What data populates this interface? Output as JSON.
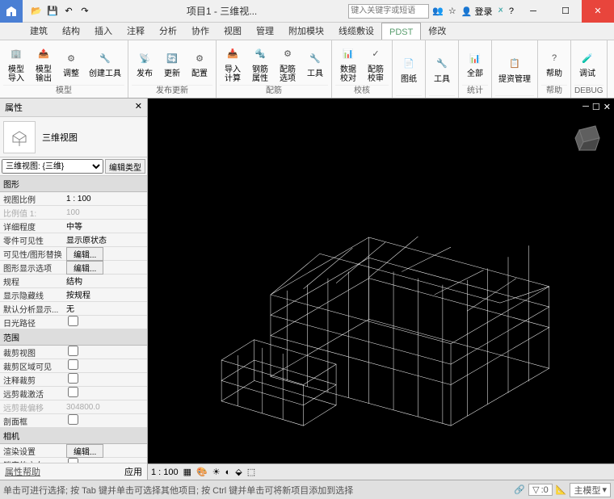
{
  "title": "项目1 - 三维视...",
  "searchPlaceholder": "键入关键字或短语",
  "login": "登录",
  "menus": [
    "建筑",
    "结构",
    "插入",
    "注释",
    "分析",
    "协作",
    "视图",
    "管理",
    "附加模块",
    "线缆敷设",
    "PDST",
    "修改"
  ],
  "activeMenu": 10,
  "ribbonGroups": [
    {
      "label": "模型",
      "items": [
        {
          "l": "模型\n导入"
        },
        {
          "l": "模型\n输出"
        },
        {
          "l": "调整"
        },
        {
          "l": "创建工具"
        }
      ]
    },
    {
      "label": "发布更新",
      "items": [
        {
          "l": "发布"
        },
        {
          "l": "更新"
        },
        {
          "l": "配置"
        }
      ]
    },
    {
      "label": "配筋",
      "items": [
        {
          "l": "导入\n计算"
        },
        {
          "l": "钢筋\n属性"
        },
        {
          "l": "配筋\n选项"
        },
        {
          "l": "工具"
        }
      ]
    },
    {
      "label": "校核",
      "items": [
        {
          "l": "数据\n校对"
        },
        {
          "l": "配筋\n校审"
        }
      ]
    },
    {
      "label": "",
      "items": [
        {
          "l": "图纸"
        }
      ]
    },
    {
      "label": "",
      "items": [
        {
          "l": "工具"
        }
      ]
    },
    {
      "label": "统计",
      "items": [
        {
          "l": "全部"
        }
      ]
    },
    {
      "label": "",
      "items": [
        {
          "l": "提资管理"
        }
      ]
    },
    {
      "label": "帮助",
      "items": [
        {
          "l": "帮助"
        }
      ]
    },
    {
      "label": "DEBUG",
      "items": [
        {
          "l": "调试"
        }
      ]
    }
  ],
  "props": {
    "title": "属性",
    "viewName": "三维视图",
    "selectorLabel": "三维视图: {三维}",
    "editType": "编辑类型",
    "sections": [
      {
        "name": "图形",
        "rows": [
          {
            "k": "视图比例",
            "v": "1 : 100",
            "t": "text"
          },
          {
            "k": "比例值 1:",
            "v": "100",
            "t": "text",
            "dim": true
          },
          {
            "k": "详细程度",
            "v": "中等",
            "t": "text"
          },
          {
            "k": "零件可见性",
            "v": "显示原状态",
            "t": "text"
          },
          {
            "k": "可见性/图形替换",
            "v": "编辑...",
            "t": "btn"
          },
          {
            "k": "图形显示选项",
            "v": "编辑...",
            "t": "btn"
          },
          {
            "k": "规程",
            "v": "结构",
            "t": "text"
          },
          {
            "k": "显示隐藏线",
            "v": "按规程",
            "t": "text"
          },
          {
            "k": "默认分析显示...",
            "v": "无",
            "t": "text"
          },
          {
            "k": "日光路径",
            "v": "",
            "t": "check"
          }
        ]
      },
      {
        "name": "范围",
        "rows": [
          {
            "k": "裁剪视图",
            "v": "",
            "t": "check"
          },
          {
            "k": "裁剪区域可见",
            "v": "",
            "t": "check"
          },
          {
            "k": "注释裁剪",
            "v": "",
            "t": "check"
          },
          {
            "k": "远剪裁激活",
            "v": "",
            "t": "check"
          },
          {
            "k": "远剪裁偏移",
            "v": "304800.0",
            "t": "text",
            "dim": true
          },
          {
            "k": "剖面框",
            "v": "",
            "t": "check"
          }
        ]
      },
      {
        "name": "相机",
        "rows": [
          {
            "k": "渲染设置",
            "v": "编辑...",
            "t": "btn"
          },
          {
            "k": "锁定的方向",
            "v": "",
            "t": "check"
          }
        ]
      }
    ],
    "help": "属性帮助",
    "apply": "应用"
  },
  "viewToolbar": {
    "scale": "1 : 100"
  },
  "statusText": "单击可进行选择; 按 Tab 键并单击可选择其他项目; 按 Ctrl 键并单击可将新项目添加到选择",
  "statusRight": {
    "count": ":0",
    "model": "主模型"
  }
}
